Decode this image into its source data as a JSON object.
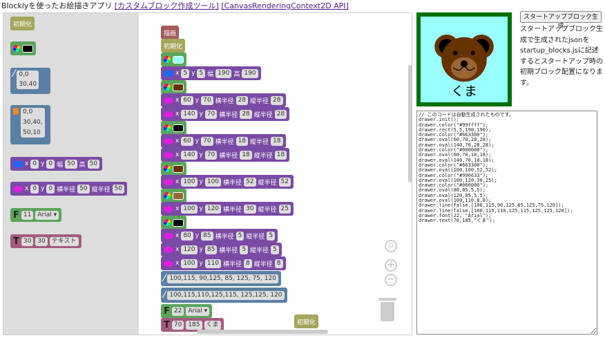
{
  "header": {
    "title": "Blocklyを使ったお絵描きアプリ",
    "link1": "[カスタムブロック作成ツール]",
    "link2": "[CanvasRenderingContext2D API]"
  },
  "toolbox": {
    "init_label": "初期化",
    "line": {
      "v1": "0,0",
      "v2": "30,40"
    },
    "poly": {
      "v1": "0,0",
      "v2": "30,40,",
      "v3": "50,10"
    },
    "rect": {
      "x_label": "x",
      "x": "0",
      "y_label": "y",
      "y": "0",
      "w_label": "幅",
      "w": "50",
      "h_label": "高",
      "h": "50"
    },
    "oval": {
      "x_label": "x",
      "x": "0",
      "y_label": "y",
      "y": "0",
      "rx_label": "横半径",
      "rx": "50",
      "ry_label": "縦半径",
      "ry": "50"
    },
    "font": {
      "letter": "F",
      "size": "11",
      "family": "Arial ▾"
    },
    "text": {
      "letter": "T",
      "x": "30",
      "y": "30",
      "value": "テキスト"
    }
  },
  "main": {
    "draw_label": "描画",
    "init_label": "初期化",
    "rect1": {
      "x": "5",
      "y": "5",
      "w": "190",
      "h": "190"
    },
    "ovals": [
      {
        "x": "60",
        "y": "70",
        "rx": "28",
        "ry": "28"
      },
      {
        "x": "140",
        "y": "70",
        "rx": "28",
        "ry": "28"
      },
      {
        "x": "60",
        "y": "70",
        "rx": "18",
        "ry": "18"
      },
      {
        "x": "140",
        "y": "70",
        "rx": "18",
        "ry": "18"
      },
      {
        "x": "100",
        "y": "100",
        "rx": "52",
        "ry": "52"
      },
      {
        "x": "100",
        "y": "120",
        "rx": "30",
        "ry": "25"
      },
      {
        "x": "80",
        "y": "85",
        "rx": "5",
        "ry": "5"
      },
      {
        "x": "120",
        "y": "85",
        "rx": "5",
        "ry": "5"
      },
      {
        "x": "100",
        "y": "110",
        "rx": "8",
        "ry": "8"
      }
    ],
    "labels": {
      "x": "x",
      "y": "y",
      "w": "幅",
      "h": "高",
      "rx": "横半径",
      "ry": "縦半径"
    },
    "line1": "100,115, 90,125, 85, 125, 75, 120",
    "line2": "100,115,110,125,115, 125,125, 120",
    "font": {
      "letter": "F",
      "size": "22",
      "family": "Arial ▾"
    },
    "text": {
      "letter": "T",
      "x": "70",
      "y": "185",
      "value": "くま"
    },
    "floating_init": "初期化"
  },
  "colors": {
    "cyan": "#99ffff",
    "brown": "#663300",
    "black": "#000000",
    "tan": "#996633",
    "frame": "#007000"
  },
  "canvas_text": "くま",
  "generate_button": "スタートアップブロック生成",
  "description": "スタートアップブロック生成で生成されたjsonをstartup_blocks.jsに記述するとスタートアップ時の初期ブロック配置になります。",
  "code": "// このコードは自動生成されたものです。\ndrawer.init();\ndrawer.color(\"#99ffff\");\ndrawer.rect(5,5,190,190);\ndrawer.color(\"#663300\");\ndrawer.oval(60,70,28,28);\ndrawer.oval(140,70,28,28);\ndrawer.color(\"#000000\");\ndrawer.oval(60,70,18,18);\ndrawer.oval(140,70,18,18);\ndrawer.color(\"#663300\");\ndrawer.oval(100,100,52,52);\ndrawer.color(\"#996633\");\ndrawer.oval(100,120,30,25);\ndrawer.color(\"#000000\");\ndrawer.oval(80,85,5,5);\ndrawer.oval(120,85,5,5);\ndrawer.oval(100,110,8,8);\ndrawer.line(false,[100,115,90,125,85,125,75,120]);\ndrawer.line(false,[100,115,110,125,115,125,125,120]);\ndrawer.font(22, \"Arial\");\ndrawer.text(70,185,\"くま\");"
}
